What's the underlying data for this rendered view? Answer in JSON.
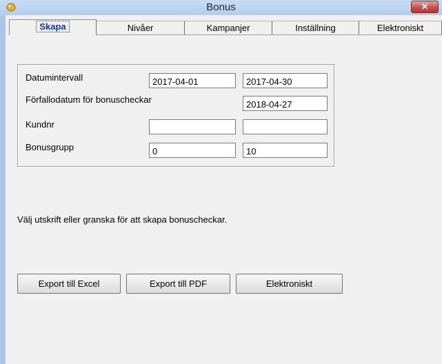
{
  "window": {
    "title": "Bonus",
    "close_label": "✕"
  },
  "tabs": [
    {
      "label": "Skapa",
      "active": true
    },
    {
      "label": "Nivåer",
      "active": false
    },
    {
      "label": "Kampanjer",
      "active": false
    },
    {
      "label": "Inställning",
      "active": false
    },
    {
      "label": "Elektroniskt",
      "active": false
    }
  ],
  "form": {
    "date_range": {
      "label": "Datumintervall",
      "from": "2017-04-01",
      "to": "2017-04-30"
    },
    "due_date": {
      "label": "Förfallodatum för bonuscheckar",
      "value": "2018-04-27"
    },
    "customer_no": {
      "label": "Kundnr",
      "from": "",
      "to": ""
    },
    "bonus_group": {
      "label": "Bonusgrupp",
      "from": "0",
      "to": "10"
    }
  },
  "message": "Välj utskrift eller granska för att skapa bonuscheckar.",
  "buttons": {
    "export_excel": "Export till Excel",
    "export_pdf": "Export till PDF",
    "electronic": "Elektroniskt"
  },
  "colors": {
    "title_bar": "#b9d1ee",
    "close_button": "#c75050",
    "active_tab_text": "#0e34a8",
    "panel": "#f0f0f0"
  },
  "icons": {
    "app": "bonus-coin-icon",
    "close": "close-icon"
  }
}
